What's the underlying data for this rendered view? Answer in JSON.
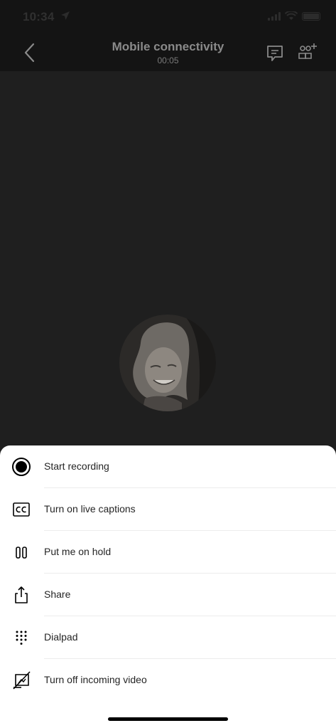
{
  "status_bar": {
    "time": "10:34"
  },
  "header": {
    "title": "Mobile connectivity",
    "timer": "00:05"
  },
  "menu": {
    "items": [
      {
        "label": "Start recording",
        "icon": "record-icon"
      },
      {
        "label": "Turn on live captions",
        "icon": "captions-icon"
      },
      {
        "label": "Put me on hold",
        "icon": "hold-icon"
      },
      {
        "label": "Share",
        "icon": "share-icon"
      },
      {
        "label": "Dialpad",
        "icon": "dialpad-icon"
      },
      {
        "label": "Turn off incoming video",
        "icon": "video-off-icon"
      }
    ]
  },
  "colors": {
    "sheet_bg": "#ffffff",
    "stage_bg": "#1f1f1f",
    "header_bg": "#141414",
    "text": "#252525"
  }
}
